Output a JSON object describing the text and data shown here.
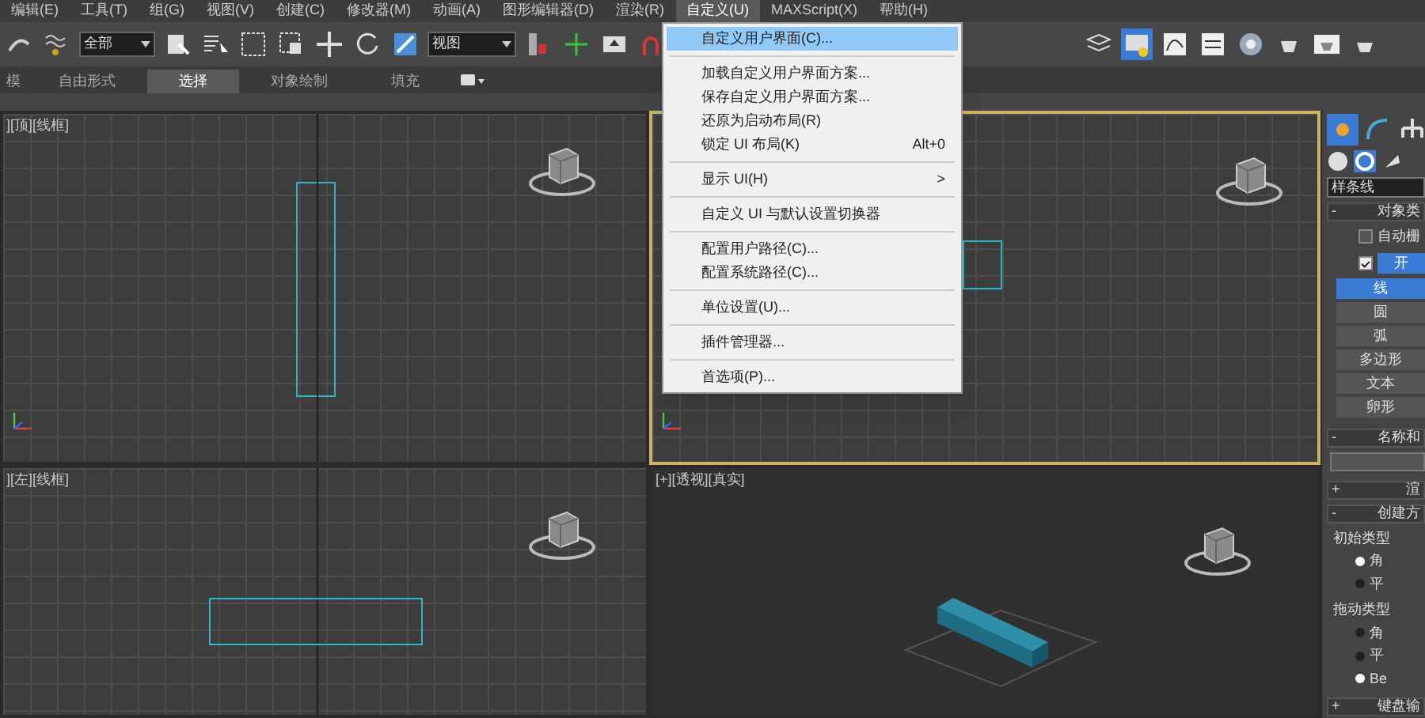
{
  "menu_bar": [
    {
      "label": "编辑(E)",
      "selected": false
    },
    {
      "label": "工具(T)",
      "selected": false
    },
    {
      "label": "组(G)",
      "selected": false
    },
    {
      "label": "视图(V)",
      "selected": false
    },
    {
      "label": "创建(C)",
      "selected": false
    },
    {
      "label": "修改器(M)",
      "selected": false
    },
    {
      "label": "动画(A)",
      "selected": false
    },
    {
      "label": "图形编辑器(D)",
      "selected": false
    },
    {
      "label": "渲染(R)",
      "selected": false
    },
    {
      "label": "自定义(U)",
      "selected": true
    },
    {
      "label": "MAXScript(X)",
      "selected": false
    },
    {
      "label": "帮助(H)",
      "selected": false
    }
  ],
  "toolbar": {
    "selection_filter": "全部",
    "reference_coord": "视图"
  },
  "ribbon_tabs": [
    {
      "label": "模",
      "selected": false
    },
    {
      "label": "自由形式",
      "selected": false
    },
    {
      "label": "选择",
      "selected": true
    },
    {
      "label": "对象绘制",
      "selected": false
    },
    {
      "label": "填充",
      "selected": false
    }
  ],
  "dropdown_menu": [
    {
      "label": "自定义用户界面(C)...",
      "selected": true,
      "separator_before": false
    },
    {
      "label": "加载自定义用户界面方案...",
      "selected": false,
      "separator_before": true
    },
    {
      "label": "保存自定义用户界面方案...",
      "selected": false,
      "separator_before": false
    },
    {
      "label": "还原为启动布局(R)",
      "selected": false,
      "separator_before": false
    },
    {
      "label": "锁定 UI 布局(K)",
      "shortcut": "Alt+0",
      "selected": false,
      "separator_before": false
    },
    {
      "label": "显示 UI(H)",
      "submenu": ">",
      "selected": false,
      "separator_before": true
    },
    {
      "label": "自定义 UI 与默认设置切换器",
      "selected": false,
      "separator_before": true
    },
    {
      "label": "配置用户路径(C)...",
      "selected": false,
      "separator_before": true
    },
    {
      "label": "配置系统路径(C)...",
      "selected": false,
      "separator_before": false
    },
    {
      "label": "单位设置(U)...",
      "selected": false,
      "separator_before": true
    },
    {
      "label": "插件管理器...",
      "selected": false,
      "separator_before": true
    },
    {
      "label": "首选项(P)...",
      "selected": false,
      "separator_before": true
    }
  ],
  "viewports": [
    {
      "label": "][顶][线框]",
      "kind": "top",
      "active": false
    },
    {
      "kind": "front",
      "active": true
    },
    {
      "label": "][左][线框]",
      "kind": "left",
      "active": false
    },
    {
      "label": "[+][透视][真实]",
      "kind": "perspective",
      "active": false
    }
  ],
  "command_panel": {
    "category": "样条线",
    "object_type": {
      "toggle": "-",
      "title": "对象类",
      "auto_grid": {
        "label": "自动栅",
        "checked": false
      },
      "start_new": {
        "checked": true,
        "label": "开"
      },
      "buttons": [
        {
          "label": "线",
          "selected": true
        },
        {
          "label": "圆",
          "selected": false
        },
        {
          "label": "弧",
          "selected": false
        },
        {
          "label": "多边形",
          "selected": false
        },
        {
          "label": "文本",
          "selected": false
        },
        {
          "label": "卵形",
          "selected": false
        }
      ]
    },
    "name_toggle": "-",
    "name_title": "名称和",
    "rendering_toggle": "+",
    "rendering_title": "渲",
    "creation_toggle": "-",
    "creation_title": "创建方",
    "initial_type": {
      "title": "初始类型",
      "options": [
        {
          "label": "角",
          "selected": true
        },
        {
          "label": "平",
          "selected": false
        }
      ]
    },
    "drag_type": {
      "title": "拖动类型",
      "options": [
        {
          "label": "角",
          "selected": false
        },
        {
          "label": "平",
          "selected": false
        },
        {
          "label": "Be",
          "selected": true
        }
      ]
    },
    "keyboard_toggle": "+",
    "keyboard_title": "键盘输"
  }
}
